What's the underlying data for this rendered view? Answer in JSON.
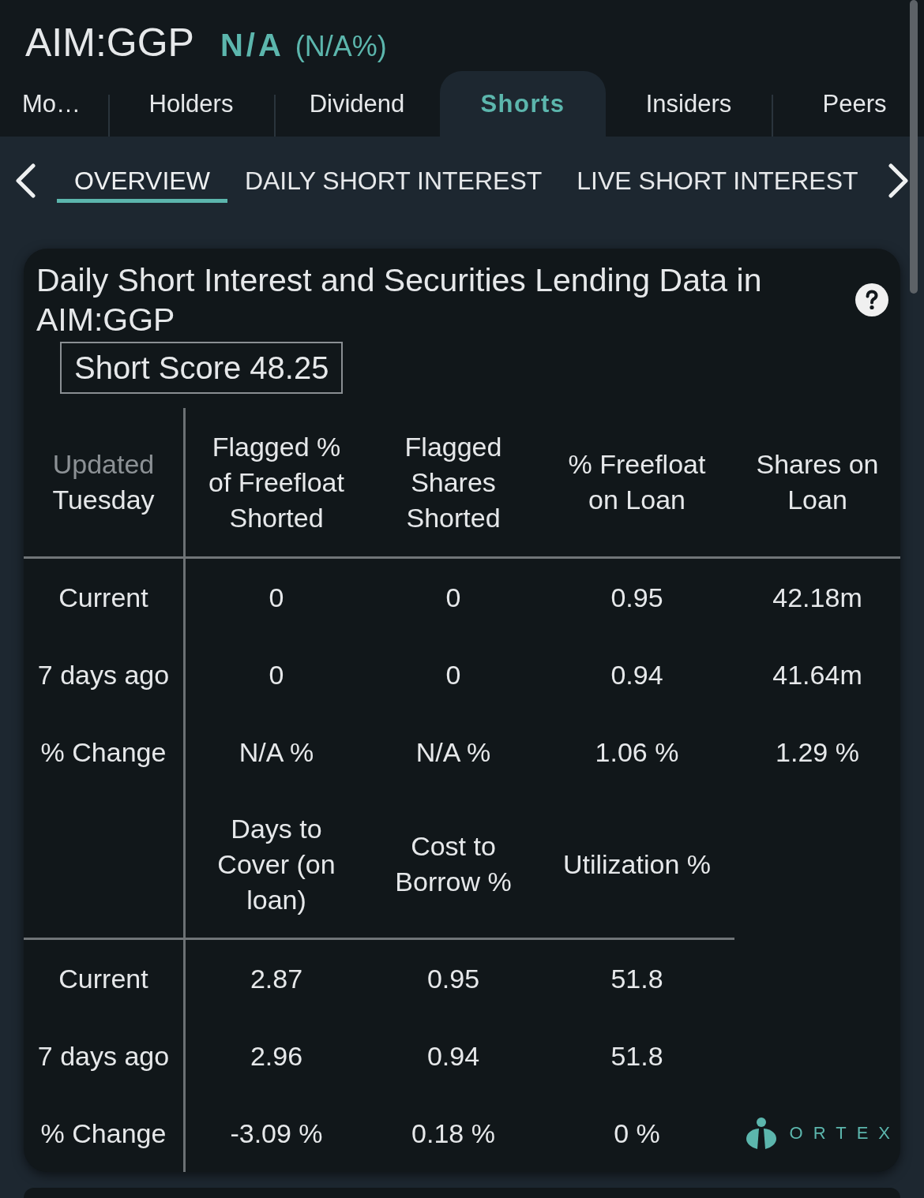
{
  "quote": {
    "symbol": "AIM:GGP",
    "price": "N/A",
    "change": "(N/A%)"
  },
  "tabs": [
    {
      "label": "Mo…",
      "selected": false
    },
    {
      "label": "Holders",
      "selected": false
    },
    {
      "label": "Dividend",
      "selected": false
    },
    {
      "label": "Shorts",
      "selected": true
    },
    {
      "label": "Insiders",
      "selected": false
    },
    {
      "label": "Peers",
      "selected": false
    }
  ],
  "subtabs": [
    {
      "label": "OVERVIEW",
      "selected": true
    },
    {
      "label": "DAILY SHORT INTEREST",
      "selected": false
    },
    {
      "label": "LIVE SHORT INTEREST",
      "selected": false
    }
  ],
  "card": {
    "title": "Daily Short Interest and Securities Lending Data in AIM:GGP",
    "short_score": "Short Score 48.25",
    "tables": [
      {
        "corner": {
          "label": "Updated",
          "value": "Tuesday"
        },
        "columns": [
          "Flagged % of Freefloat Shorted",
          "Flagged Shares Shorted",
          "% Freefloat on Loan",
          "Shares on Loan"
        ],
        "rows": [
          {
            "label": "Current",
            "values": [
              "0",
              "0",
              "0.95",
              "42.18m"
            ]
          },
          {
            "label": "7 days ago",
            "values": [
              "0",
              "0",
              "0.94",
              "41.64m"
            ]
          },
          {
            "label": "% Change",
            "values": [
              "N/A %",
              "N/A %",
              "1.06 %",
              "1.29 %"
            ]
          }
        ]
      },
      {
        "columns": [
          "Days to Cover (on loan)",
          "Cost to Borrow %",
          "Utilization %"
        ],
        "rows": [
          {
            "label": "Current",
            "values": [
              "2.87",
              "0.95",
              "51.8"
            ]
          },
          {
            "label": "7 days ago",
            "values": [
              "2.96",
              "0.94",
              "51.8"
            ]
          },
          {
            "label": "% Change",
            "values": [
              "-3.09 %",
              "0.18 %",
              "0 %"
            ]
          }
        ]
      }
    ],
    "logo": "ORTEX"
  }
}
